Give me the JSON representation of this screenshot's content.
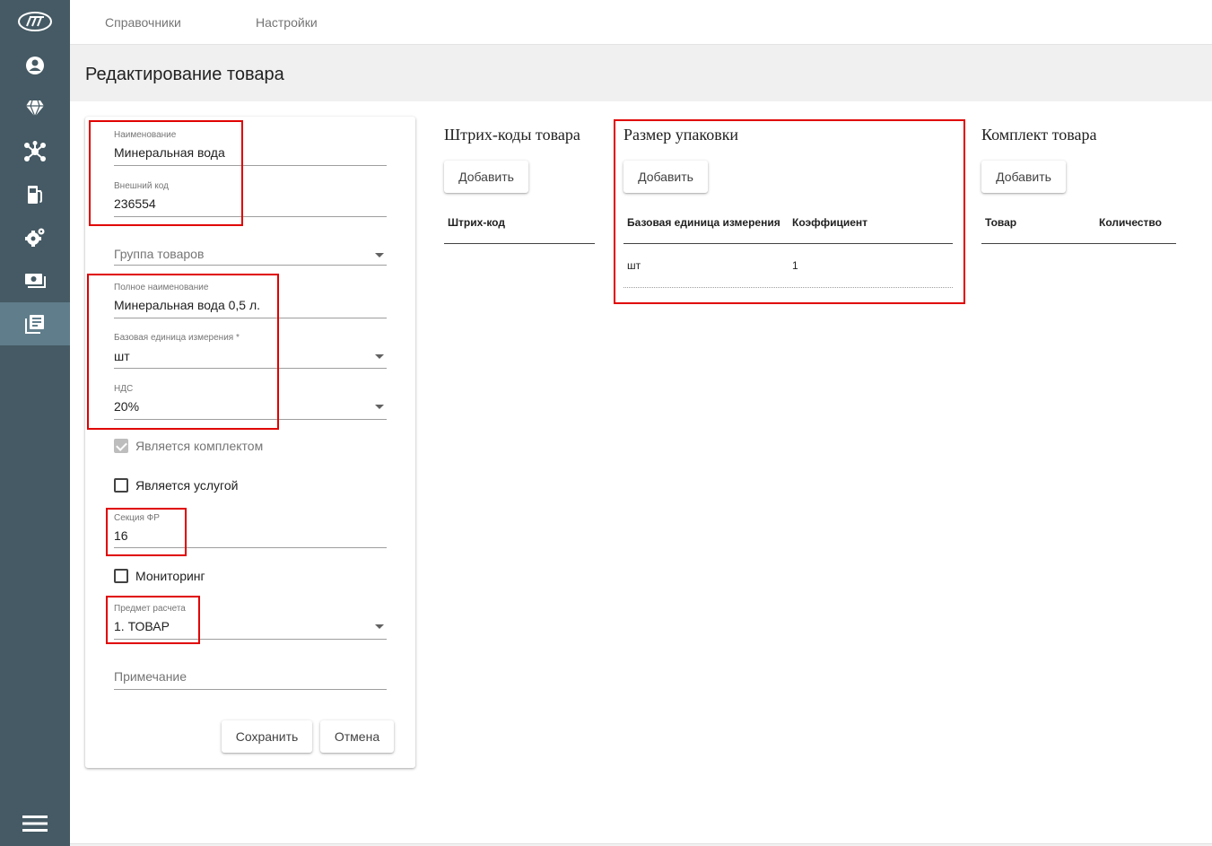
{
  "sidebar": {
    "items": [
      {
        "icon": "logo-icon"
      },
      {
        "icon": "account-icon"
      },
      {
        "icon": "diamond-icon"
      },
      {
        "icon": "network-icon"
      },
      {
        "icon": "fuel-pump-icon"
      },
      {
        "icon": "settings-icon"
      },
      {
        "icon": "cash-icon"
      },
      {
        "icon": "catalog-icon",
        "active": true
      },
      {
        "icon": "menu-icon"
      }
    ],
    "bg_color": "#455a64",
    "active_color": "#607d8b"
  },
  "topbar": {
    "nav": [
      "Справочники",
      "Настройки"
    ]
  },
  "page": {
    "title": "Редактирование товара"
  },
  "form": {
    "name": {
      "label": "Наименование",
      "value": "Минеральная вода"
    },
    "external_code": {
      "label": "Внешний код",
      "value": "236554"
    },
    "group": {
      "placeholder": "Группа товаров"
    },
    "full_name": {
      "label": "Полное наименование",
      "value": "Минеральная вода 0,5 л."
    },
    "base_unit": {
      "label": "Базовая единица измерения *",
      "value": "шт"
    },
    "vat": {
      "label": "НДС",
      "value": "20%"
    },
    "is_kit": {
      "label": "Является комплектом",
      "checked": true,
      "disabled": true
    },
    "is_service": {
      "label": "Является услугой",
      "checked": false
    },
    "fr_section": {
      "label": "Секция ФР",
      "value": "16"
    },
    "monitoring": {
      "label": "Мониторинг",
      "checked": false
    },
    "payment_subject": {
      "label": "Предмет расчета",
      "value": "1. ТОВАР"
    },
    "note": {
      "placeholder": "Примечание"
    },
    "save_label": "Сохранить",
    "cancel_label": "Отмена"
  },
  "barcodes": {
    "title": "Штрих-коды товара",
    "add_label": "Добавить",
    "columns": [
      "Штрих-код"
    ],
    "rows": []
  },
  "packaging": {
    "title": "Размер упаковки",
    "add_label": "Добавить",
    "columns": [
      "Базовая единица измерения",
      "Коэффициент"
    ],
    "rows": [
      [
        "шт",
        "1"
      ]
    ]
  },
  "kit": {
    "title": "Комплект товара",
    "add_label": "Добавить",
    "columns": [
      "Товар",
      "Количество"
    ],
    "rows": []
  },
  "highlight_color": "#e00000"
}
